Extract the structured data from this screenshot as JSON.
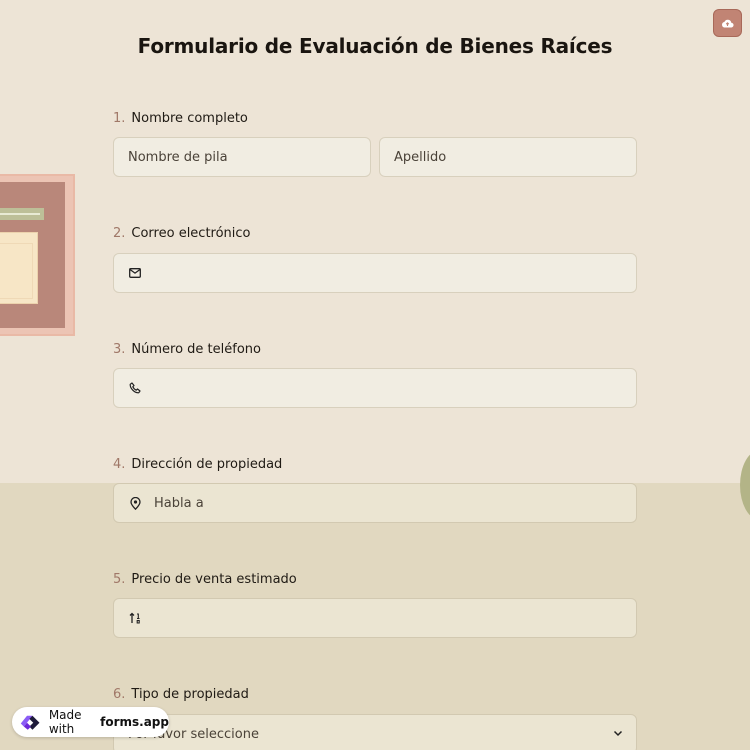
{
  "title": "Formulario de Evaluación de Bienes Raíces",
  "questions": [
    {
      "number": "1.",
      "label": "Nombre completo",
      "first_placeholder": "Nombre de pila",
      "last_placeholder": "Apellido"
    },
    {
      "number": "2.",
      "label": "Correo electrónico",
      "icon": "mail-icon",
      "value": ""
    },
    {
      "number": "3.",
      "label": "Número de teléfono",
      "icon": "phone-icon",
      "value": ""
    },
    {
      "number": "4.",
      "label": "Dirección de propiedad",
      "icon": "map-pin-icon",
      "value": "Habla a"
    },
    {
      "number": "5.",
      "label": "Precio de venta estimado",
      "icon": "sort-numbers-icon",
      "value": ""
    },
    {
      "number": "6.",
      "label": "Tipo de propiedad",
      "icon": "chevron-down-icon",
      "value": "Por favor seleccione"
    }
  ],
  "badge": {
    "prefix": "Made with",
    "brand": "forms.app"
  },
  "colors": {
    "accent": "#c18474",
    "page_top": "#ede4d6",
    "page_bottom": "#e1d8c0"
  }
}
